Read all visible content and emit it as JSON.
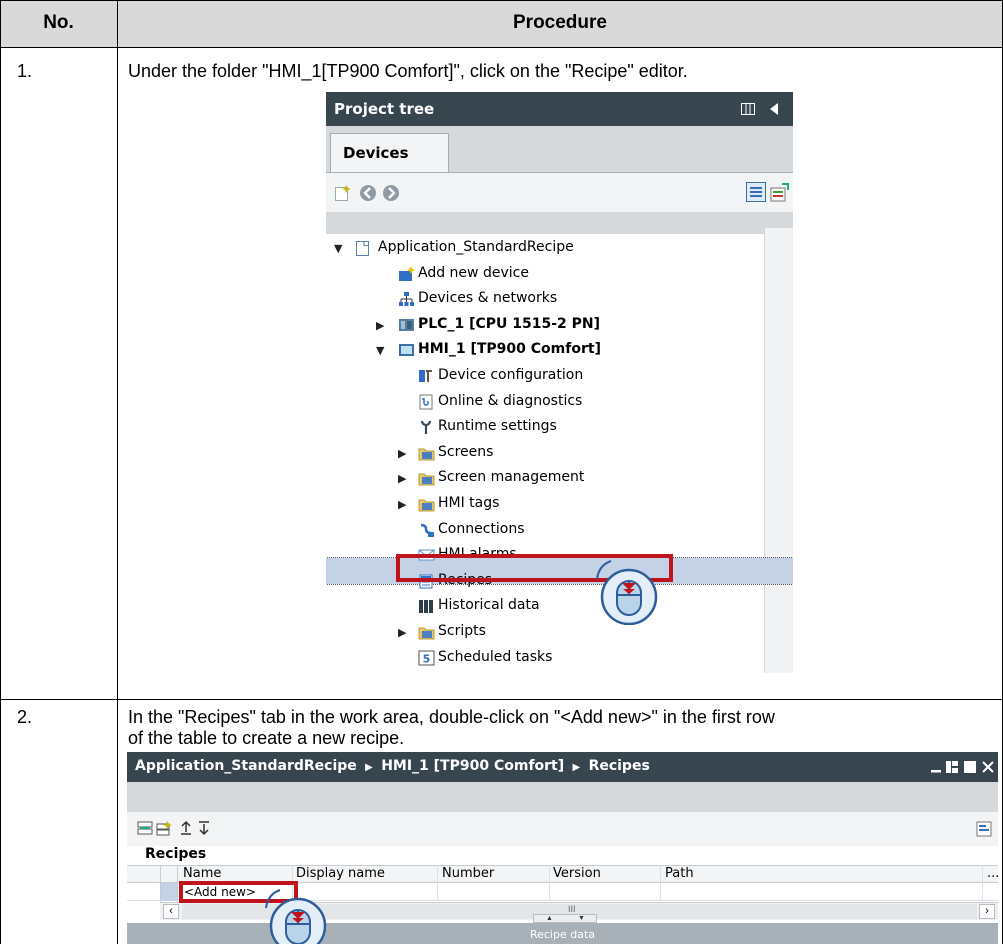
{
  "table": {
    "headers": {
      "no": "No.",
      "procedure": "Procedure"
    },
    "rows": [
      {
        "no": "1.",
        "text": "Under the folder \"HMI_1[TP900 Comfort]\", click on the \"Recipe\" editor."
      },
      {
        "no": "2.",
        "text_line1": "In the \"Recipes\" tab in the work area, double-click on \"<Add new>\" in the first row",
        "text_line2": "of the table to create a new recipe."
      }
    ]
  },
  "project_tree": {
    "title": "Project tree",
    "tab": "Devices",
    "items": [
      {
        "label": "Application_StandardRecipe",
        "icon": "project-icon",
        "expanded": true
      },
      {
        "label": "Add new device",
        "icon": "add-device-icon"
      },
      {
        "label": "Devices & networks",
        "icon": "network-icon"
      },
      {
        "label": "PLC_1 [CPU 1515-2 PN]",
        "icon": "plc-icon",
        "expanded": false
      },
      {
        "label": "HMI_1 [TP900 Comfort]",
        "icon": "hmi-icon",
        "expanded": true
      },
      {
        "label": "Device configuration",
        "icon": "device-config-icon"
      },
      {
        "label": "Online & diagnostics",
        "icon": "diagnostics-icon"
      },
      {
        "label": "Runtime settings",
        "icon": "runtime-settings-icon"
      },
      {
        "label": "Screens",
        "icon": "folder-icon"
      },
      {
        "label": "Screen management",
        "icon": "folder-icon"
      },
      {
        "label": "HMI tags",
        "icon": "folder-icon"
      },
      {
        "label": "Connections",
        "icon": "connections-icon"
      },
      {
        "label": "HMI alarms",
        "icon": "alarms-icon"
      },
      {
        "label": "Recipes",
        "icon": "recipes-icon",
        "selected": true
      },
      {
        "label": "Historical data",
        "icon": "historical-data-icon"
      },
      {
        "label": "Scripts",
        "icon": "folder-icon"
      },
      {
        "label": "Scheduled tasks",
        "icon": "scheduled-tasks-icon"
      }
    ]
  },
  "recipe_editor": {
    "breadcrumb": [
      "Application_StandardRecipe",
      "HMI_1 [TP900 Comfort]",
      "Recipes"
    ],
    "section_title": "Recipes",
    "columns": [
      "Name",
      "Display name",
      "Number",
      "Version",
      "Path"
    ],
    "add_new": "<Add new>",
    "recipe_data_label": "Recipe data",
    "scroll_label": "III",
    "more_label": "..."
  },
  "colors": {
    "titlebar": "#37454f",
    "highlight_box": "#c0141c",
    "selection": "#c5d2e6"
  }
}
